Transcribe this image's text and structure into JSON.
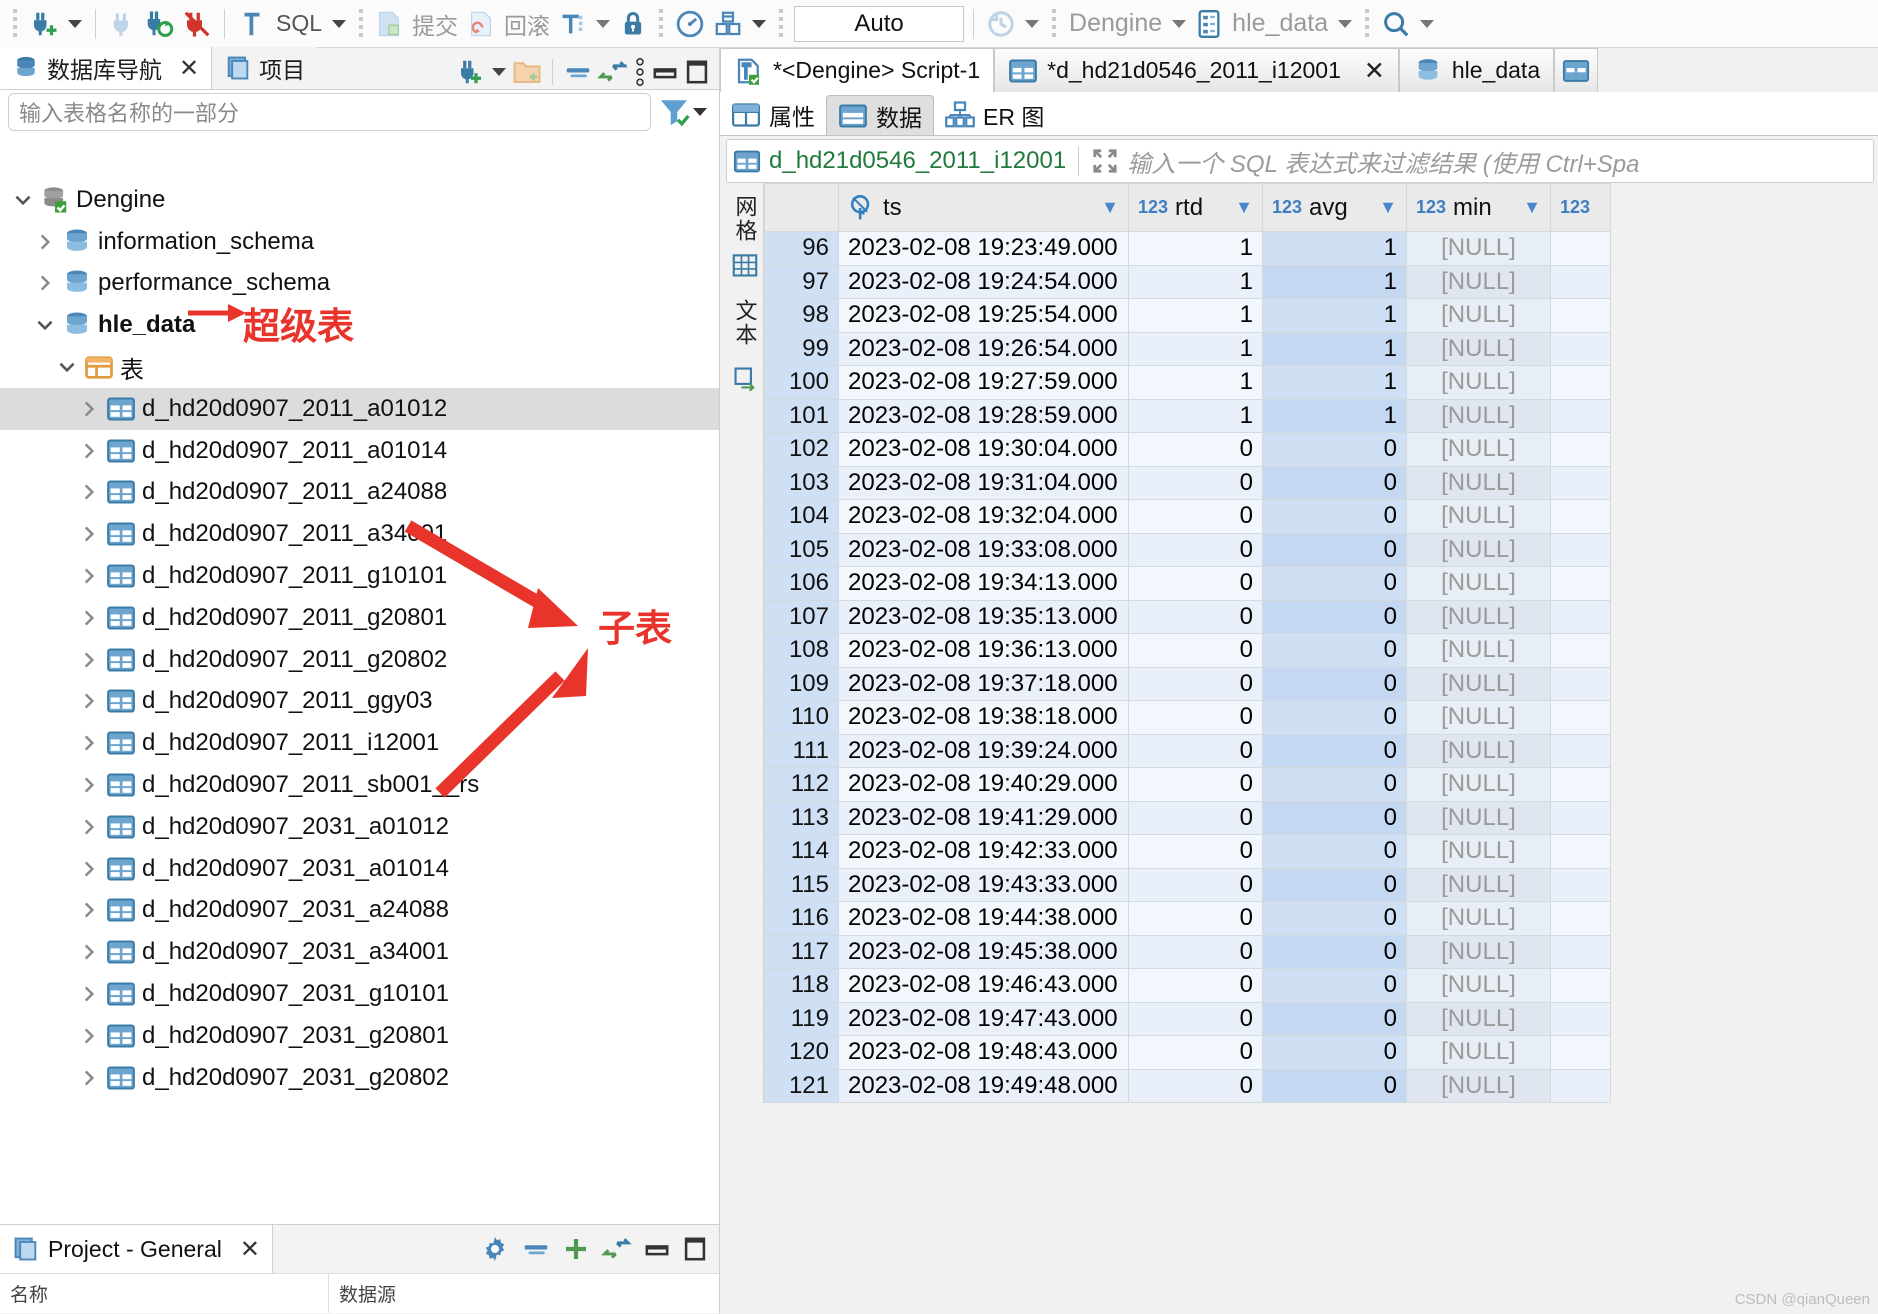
{
  "toolbar": {
    "icons": [
      {
        "name": "new-connection-icon",
        "label": ""
      },
      {
        "name": "disconnect-icon",
        "label": ""
      },
      {
        "name": "refresh-connection-icon",
        "label": ""
      },
      {
        "name": "disconnect-all-icon",
        "label": ""
      },
      {
        "name": "sql-editor-icon",
        "label": "SQL"
      },
      {
        "name": "commit-icon",
        "label": "提交"
      },
      {
        "name": "rollback-icon",
        "label": "回滚"
      },
      {
        "name": "transaction-mode-icon",
        "label": ""
      },
      {
        "name": "lock-icon",
        "label": ""
      },
      {
        "name": "dashboard-icon",
        "label": ""
      },
      {
        "name": "packages-icon",
        "label": ""
      },
      {
        "name": "history-icon",
        "label": ""
      },
      {
        "name": "search-icon",
        "label": ""
      }
    ],
    "auto_value": "Auto",
    "connection_name": "Dengine",
    "schema_name": "hle_data",
    "commit_label": "提交",
    "rollback_label": "回滚",
    "sql_label": "SQL"
  },
  "left_panel": {
    "tabs": [
      {
        "label": "数据库导航",
        "icon": "database-navigator-icon",
        "active": true,
        "closable": true
      },
      {
        "label": "项目",
        "icon": "project-icon",
        "active": false,
        "closable": false
      }
    ],
    "tools": [
      {
        "name": "new-connection-icon"
      },
      {
        "name": "new-folder-icon"
      },
      {
        "name": "collapse-all-icon"
      },
      {
        "name": "link-editor-icon"
      },
      {
        "name": "view-menu-icon"
      },
      {
        "name": "minimize-icon"
      },
      {
        "name": "maximize-icon"
      }
    ],
    "filter_placeholder": "输入表格名称的一部分",
    "filter_value": "",
    "tree": [
      {
        "label": "Dengine",
        "depth": 0,
        "icon": "database-connection-icon",
        "expanded": true,
        "bold": false,
        "selected": false
      },
      {
        "label": "information_schema",
        "depth": 1,
        "icon": "schema-icon",
        "expanded": false,
        "bold": false,
        "selected": false
      },
      {
        "label": "performance_schema",
        "depth": 1,
        "icon": "schema-icon",
        "expanded": false,
        "bold": false,
        "selected": false
      },
      {
        "label": "hle_data",
        "depth": 1,
        "icon": "schema-icon",
        "expanded": true,
        "bold": true,
        "selected": false
      },
      {
        "label": "表",
        "depth": 2,
        "icon": "tables-folder-icon",
        "expanded": true,
        "bold": false,
        "selected": false
      },
      {
        "label": "d_hd20d0907_2011_a01012",
        "depth": 3,
        "icon": "table-icon",
        "expanded": false,
        "bold": false,
        "selected": true
      },
      {
        "label": "d_hd20d0907_2011_a01014",
        "depth": 3,
        "icon": "table-icon",
        "expanded": false,
        "bold": false,
        "selected": false
      },
      {
        "label": "d_hd20d0907_2011_a24088",
        "depth": 3,
        "icon": "table-icon",
        "expanded": false,
        "bold": false,
        "selected": false
      },
      {
        "label": "d_hd20d0907_2011_a34001",
        "depth": 3,
        "icon": "table-icon",
        "expanded": false,
        "bold": false,
        "selected": false
      },
      {
        "label": "d_hd20d0907_2011_g10101",
        "depth": 3,
        "icon": "table-icon",
        "expanded": false,
        "bold": false,
        "selected": false
      },
      {
        "label": "d_hd20d0907_2011_g20801",
        "depth": 3,
        "icon": "table-icon",
        "expanded": false,
        "bold": false,
        "selected": false
      },
      {
        "label": "d_hd20d0907_2011_g20802",
        "depth": 3,
        "icon": "table-icon",
        "expanded": false,
        "bold": false,
        "selected": false
      },
      {
        "label": "d_hd20d0907_2011_ggy03",
        "depth": 3,
        "icon": "table-icon",
        "expanded": false,
        "bold": false,
        "selected": false
      },
      {
        "label": "d_hd20d0907_2011_i12001",
        "depth": 3,
        "icon": "table-icon",
        "expanded": false,
        "bold": false,
        "selected": false
      },
      {
        "label": "d_hd20d0907_2011_sb001__rs",
        "depth": 3,
        "icon": "table-icon",
        "expanded": false,
        "bold": false,
        "selected": false
      },
      {
        "label": "d_hd20d0907_2031_a01012",
        "depth": 3,
        "icon": "table-icon",
        "expanded": false,
        "bold": false,
        "selected": false
      },
      {
        "label": "d_hd20d0907_2031_a01014",
        "depth": 3,
        "icon": "table-icon",
        "expanded": false,
        "bold": false,
        "selected": false
      },
      {
        "label": "d_hd20d0907_2031_a24088",
        "depth": 3,
        "icon": "table-icon",
        "expanded": false,
        "bold": false,
        "selected": false
      },
      {
        "label": "d_hd20d0907_2031_a34001",
        "depth": 3,
        "icon": "table-icon",
        "expanded": false,
        "bold": false,
        "selected": false
      },
      {
        "label": "d_hd20d0907_2031_g10101",
        "depth": 3,
        "icon": "table-icon",
        "expanded": false,
        "bold": false,
        "selected": false
      },
      {
        "label": "d_hd20d0907_2031_g20801",
        "depth": 3,
        "icon": "table-icon",
        "expanded": false,
        "bold": false,
        "selected": false
      },
      {
        "label": "d_hd20d0907_2031_g20802",
        "depth": 3,
        "icon": "table-icon",
        "expanded": false,
        "bold": false,
        "selected": false
      }
    ]
  },
  "annotations": {
    "accent_color": "#e8342a",
    "super_table_label": "超级表",
    "child_table_label": "子表"
  },
  "bottom_panel": {
    "tab_label": "Project - General",
    "tab_icon": "project-icon",
    "close_label": "✕",
    "tools": [
      {
        "name": "gear-icon"
      },
      {
        "name": "collapse-all-icon"
      },
      {
        "name": "add-icon"
      },
      {
        "name": "link-editor-icon"
      },
      {
        "name": "minimize-icon"
      },
      {
        "name": "maximize-icon"
      }
    ],
    "columns": [
      "名称",
      "数据源"
    ]
  },
  "editor": {
    "tabs": [
      {
        "label": "*<Dengine> Script-1",
        "icon": "sql-script-icon",
        "active": true,
        "closable": false
      },
      {
        "label": "*d_hd21d0546_2011_i12001",
        "icon": "table-icon",
        "active": false,
        "closable": true
      },
      {
        "label": "hle_data",
        "icon": "schema-icon",
        "active": false,
        "closable": false
      }
    ],
    "sub_tabs": [
      {
        "label": "属性",
        "icon": "properties-icon",
        "active": false
      },
      {
        "label": "数据",
        "icon": "data-icon",
        "active": true
      },
      {
        "label": "ER 图",
        "icon": "er-diagram-icon",
        "active": false
      }
    ]
  },
  "grid": {
    "table_name": "d_hd21d0546_2011_i12001",
    "expand_icon": "expand-filter-icon",
    "filter_placeholder": "输入一个 SQL 表达式来过滤结果 (使用 Ctrl+Spa",
    "side_tabs": [
      {
        "label": "网格",
        "name": "grid-view-tab"
      },
      {
        "label": "文本",
        "name": "text-view-tab"
      }
    ],
    "side_icons": [
      "grid-icon",
      "text-icon",
      "transpose-icon"
    ],
    "columns": [
      {
        "label": "ts",
        "type_badge": "key",
        "sortable": true,
        "selected": false
      },
      {
        "label": "rtd",
        "type_badge": "123",
        "sortable": true,
        "selected": false
      },
      {
        "label": "avg",
        "type_badge": "123",
        "sortable": true,
        "selected": true
      },
      {
        "label": "min",
        "type_badge": "123",
        "sortable": true,
        "selected": false
      },
      {
        "label": "",
        "type_badge": "123",
        "sortable": false,
        "selected": false
      }
    ],
    "null_text": "[NULL]",
    "rows": [
      {
        "n": "96",
        "ts": "2023-02-08 19:23:49.000",
        "rtd": "1",
        "avg": "1",
        "min": "[NULL]"
      },
      {
        "n": "97",
        "ts": "2023-02-08 19:24:54.000",
        "rtd": "1",
        "avg": "1",
        "min": "[NULL]"
      },
      {
        "n": "98",
        "ts": "2023-02-08 19:25:54.000",
        "rtd": "1",
        "avg": "1",
        "min": "[NULL]"
      },
      {
        "n": "99",
        "ts": "2023-02-08 19:26:54.000",
        "rtd": "1",
        "avg": "1",
        "min": "[NULL]"
      },
      {
        "n": "100",
        "ts": "2023-02-08 19:27:59.000",
        "rtd": "1",
        "avg": "1",
        "min": "[NULL]"
      },
      {
        "n": "101",
        "ts": "2023-02-08 19:28:59.000",
        "rtd": "1",
        "avg": "1",
        "min": "[NULL]"
      },
      {
        "n": "102",
        "ts": "2023-02-08 19:30:04.000",
        "rtd": "0",
        "avg": "0",
        "min": "[NULL]"
      },
      {
        "n": "103",
        "ts": "2023-02-08 19:31:04.000",
        "rtd": "0",
        "avg": "0",
        "min": "[NULL]"
      },
      {
        "n": "104",
        "ts": "2023-02-08 19:32:04.000",
        "rtd": "0",
        "avg": "0",
        "min": "[NULL]"
      },
      {
        "n": "105",
        "ts": "2023-02-08 19:33:08.000",
        "rtd": "0",
        "avg": "0",
        "min": "[NULL]"
      },
      {
        "n": "106",
        "ts": "2023-02-08 19:34:13.000",
        "rtd": "0",
        "avg": "0",
        "min": "[NULL]"
      },
      {
        "n": "107",
        "ts": "2023-02-08 19:35:13.000",
        "rtd": "0",
        "avg": "0",
        "min": "[NULL]"
      },
      {
        "n": "108",
        "ts": "2023-02-08 19:36:13.000",
        "rtd": "0",
        "avg": "0",
        "min": "[NULL]"
      },
      {
        "n": "109",
        "ts": "2023-02-08 19:37:18.000",
        "rtd": "0",
        "avg": "0",
        "min": "[NULL]"
      },
      {
        "n": "110",
        "ts": "2023-02-08 19:38:18.000",
        "rtd": "0",
        "avg": "0",
        "min": "[NULL]"
      },
      {
        "n": "111",
        "ts": "2023-02-08 19:39:24.000",
        "rtd": "0",
        "avg": "0",
        "min": "[NULL]"
      },
      {
        "n": "112",
        "ts": "2023-02-08 19:40:29.000",
        "rtd": "0",
        "avg": "0",
        "min": "[NULL]"
      },
      {
        "n": "113",
        "ts": "2023-02-08 19:41:29.000",
        "rtd": "0",
        "avg": "0",
        "min": "[NULL]"
      },
      {
        "n": "114",
        "ts": "2023-02-08 19:42:33.000",
        "rtd": "0",
        "avg": "0",
        "min": "[NULL]"
      },
      {
        "n": "115",
        "ts": "2023-02-08 19:43:33.000",
        "rtd": "0",
        "avg": "0",
        "min": "[NULL]"
      },
      {
        "n": "116",
        "ts": "2023-02-08 19:44:38.000",
        "rtd": "0",
        "avg": "0",
        "min": "[NULL]"
      },
      {
        "n": "117",
        "ts": "2023-02-08 19:45:38.000",
        "rtd": "0",
        "avg": "0",
        "min": "[NULL]"
      },
      {
        "n": "118",
        "ts": "2023-02-08 19:46:43.000",
        "rtd": "0",
        "avg": "0",
        "min": "[NULL]"
      },
      {
        "n": "119",
        "ts": "2023-02-08 19:47:43.000",
        "rtd": "0",
        "avg": "0",
        "min": "[NULL]"
      },
      {
        "n": "120",
        "ts": "2023-02-08 19:48:43.000",
        "rtd": "0",
        "avg": "0",
        "min": "[NULL]"
      },
      {
        "n": "121",
        "ts": "2023-02-08 19:49:48.000",
        "rtd": "0",
        "avg": "0",
        "min": "[NULL]"
      }
    ]
  },
  "watermark": "CSDN @qianQueen"
}
